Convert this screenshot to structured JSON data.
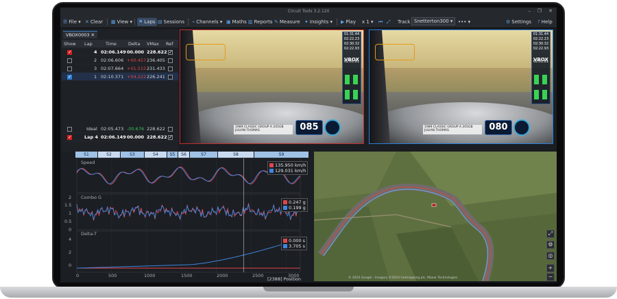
{
  "app": {
    "title": "Circuit Tools 3.2.120",
    "window_buttons": [
      "–",
      "❐",
      "✕"
    ]
  },
  "toolbar": {
    "file": "File",
    "clear": "Clear",
    "view": "View",
    "laps": "Laps",
    "sessions": "Sessions",
    "channels": "Channels",
    "maths": "Maths",
    "reports": "Reports",
    "measure": "Measure",
    "insights": "Insights",
    "play": "Play",
    "speed": "x 1",
    "track_label": "Track",
    "track_value": "Snetterton300",
    "more": "•••",
    "settings": "Settings",
    "help": "Help"
  },
  "laps": {
    "tab": "VBOX0003",
    "headers": [
      "Show",
      "Lap",
      "Time",
      "Delta",
      "VMax",
      "Ref"
    ],
    "rows": [
      {
        "lap": "4",
        "time": "02:06.149",
        "delta": "00.000",
        "vmax": "228.622",
        "show": "red",
        "ref": true,
        "bold": true
      },
      {
        "lap": "2",
        "time": "02:06.606",
        "delta": "+00.457",
        "vmax": "236.405",
        "show": "none",
        "ref": false
      },
      {
        "lap": "3",
        "time": "02:07.664",
        "delta": "+01.515",
        "vmax": "231.433",
        "show": "none",
        "ref": false
      },
      {
        "lap": "1",
        "time": "02:10.371",
        "delta": "+04.222",
        "vmax": "226.241",
        "show": "blue",
        "ref": false
      }
    ],
    "ideal": {
      "lap": "Ideal",
      "time": "02:05.473",
      "delta": "-00.676",
      "vmax": "228.622"
    },
    "current": {
      "lap": "Lap 4",
      "time": "02:06.149",
      "delta": "00.000",
      "vmax": "228.622"
    }
  },
  "video1": {
    "speed": "085",
    "vbox": "VBOX",
    "name_line1": "1989 CLASSIC GROUP A 205GB",
    "name_line2": "JULIAN THOMAS",
    "hud": [
      "01:31.44",
      "02:22.23",
      "02:30.32",
      "02:22.93",
      "02:01.81"
    ]
  },
  "video2": {
    "speed": "080",
    "vbox": "VBOX",
    "name_line1": "1989 CLASSIC GROUP A 205GB",
    "name_line2": "JULIAN THOMAS",
    "hud": [
      "01:31.44",
      "02:22.23",
      "02:30.32",
      "02:22.93",
      "02:01.81"
    ]
  },
  "sectors": [
    "S1",
    "S2",
    "S3",
    "S4",
    "S5",
    "S6",
    "S7",
    "S8",
    "S9"
  ],
  "charts": {
    "speed": {
      "label": "Speed",
      "red": "135.950 km/h",
      "blue": "129.031 km/h"
    },
    "combo": {
      "label": "Combo G",
      "red": "0.247 g",
      "blue": "0.199 g"
    },
    "delta": {
      "label": "Delta-T",
      "red": "0.000 s",
      "blue": "3.705 s"
    },
    "position": "[2388] Position",
    "combo_ticks": [
      "2",
      "1.5",
      "1",
      "0.5",
      "0"
    ],
    "delta_ticks": [
      "4",
      "2",
      "0"
    ],
    "x_ticks": [
      "0",
      "500",
      "1000",
      "1500",
      "2000",
      "2500",
      "3000"
    ]
  },
  "chart_data": {
    "type": "line",
    "xlabel": "Position",
    "x_ticks": [
      0,
      500,
      1000,
      1500,
      2000,
      2500,
      3000
    ],
    "xlim": [
      0,
      3200
    ],
    "cursor_x": 2388,
    "series": [
      {
        "name": "Speed",
        "lap_red": 135.95,
        "lap_blue": 129.031,
        "unit": "km/h"
      },
      {
        "name": "Combo G",
        "lap_red": 0.247,
        "lap_blue": 0.199,
        "unit": "g",
        "ylim": [
          0,
          2
        ]
      },
      {
        "name": "Delta-T",
        "lap_red": 0.0,
        "lap_blue": 3.705,
        "unit": "s",
        "ylim": [
          0,
          4
        ]
      }
    ]
  },
  "map": {
    "attribution": "© 2024 Google · Imagery ©2024 Getmapping plc, Maxar Technologies",
    "controls": [
      "⤢",
      "⚙",
      "◎",
      "+",
      "−"
    ]
  },
  "colors": {
    "red": "#e0474b",
    "blue": "#3f86e0",
    "accent": "#3f7fc4"
  }
}
